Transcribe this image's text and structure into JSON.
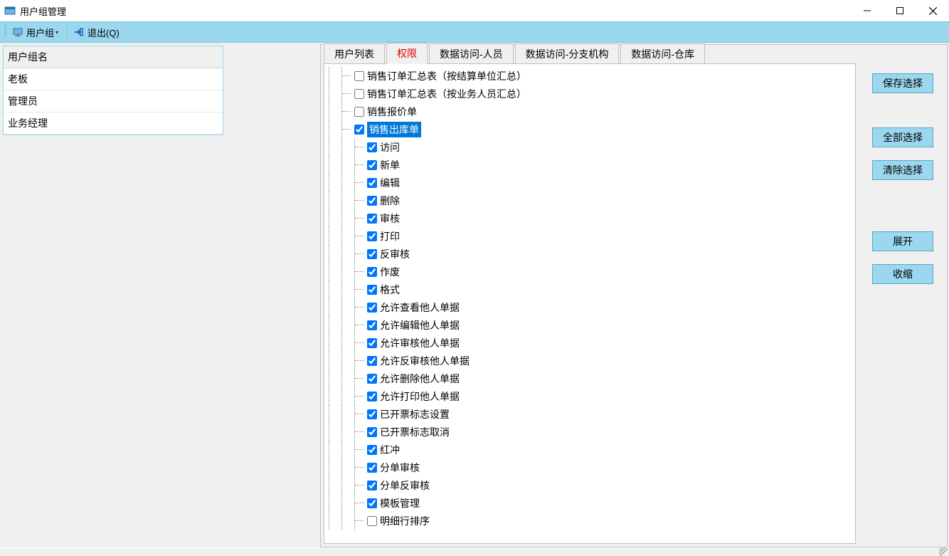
{
  "window": {
    "title": "用户组管理"
  },
  "toolbar": {
    "usergroup_label": "用户组",
    "exit_label": "退出(Q)"
  },
  "left": {
    "header": "用户组名",
    "rows": [
      "老板",
      "管理员",
      "业务经理"
    ]
  },
  "tabs": [
    "用户列表",
    "权限",
    "数据访问-人员",
    "数据访问-分支机构",
    "数据访问-仓库"
  ],
  "active_tab_index": 1,
  "buttons": {
    "save": "保存选择",
    "select_all": "全部选择",
    "clear": "清除选择",
    "expand": "展开",
    "collapse": "收缩"
  },
  "tree": [
    {
      "level": 2,
      "checked": false,
      "label": "销售订单汇总表（按结算单位汇总）",
      "selected": false
    },
    {
      "level": 2,
      "checked": false,
      "label": "销售订单汇总表（按业务人员汇总）",
      "selected": false
    },
    {
      "level": 2,
      "checked": false,
      "label": "销售报价单",
      "selected": false
    },
    {
      "level": 2,
      "checked": true,
      "label": "销售出库单",
      "selected": true
    },
    {
      "level": 3,
      "checked": true,
      "label": "访问",
      "selected": false
    },
    {
      "level": 3,
      "checked": true,
      "label": "新单",
      "selected": false
    },
    {
      "level": 3,
      "checked": true,
      "label": "编辑",
      "selected": false
    },
    {
      "level": 3,
      "checked": true,
      "label": "删除",
      "selected": false
    },
    {
      "level": 3,
      "checked": true,
      "label": "审核",
      "selected": false
    },
    {
      "level": 3,
      "checked": true,
      "label": "打印",
      "selected": false
    },
    {
      "level": 3,
      "checked": true,
      "label": "反审核",
      "selected": false
    },
    {
      "level": 3,
      "checked": true,
      "label": "作废",
      "selected": false
    },
    {
      "level": 3,
      "checked": true,
      "label": "格式",
      "selected": false
    },
    {
      "level": 3,
      "checked": true,
      "label": "允许查看他人单据",
      "selected": false
    },
    {
      "level": 3,
      "checked": true,
      "label": "允许编辑他人单据",
      "selected": false
    },
    {
      "level": 3,
      "checked": true,
      "label": "允许审核他人单据",
      "selected": false
    },
    {
      "level": 3,
      "checked": true,
      "label": "允许反审核他人单据",
      "selected": false
    },
    {
      "level": 3,
      "checked": true,
      "label": "允许删除他人单据",
      "selected": false
    },
    {
      "level": 3,
      "checked": true,
      "label": "允许打印他人单据",
      "selected": false
    },
    {
      "level": 3,
      "checked": true,
      "label": "已开票标志设置",
      "selected": false
    },
    {
      "level": 3,
      "checked": true,
      "label": "已开票标志取消",
      "selected": false
    },
    {
      "level": 3,
      "checked": true,
      "label": "红冲",
      "selected": false
    },
    {
      "level": 3,
      "checked": true,
      "label": "分单审核",
      "selected": false
    },
    {
      "level": 3,
      "checked": true,
      "label": "分单反审核",
      "selected": false
    },
    {
      "level": 3,
      "checked": true,
      "label": "模板管理",
      "selected": false
    },
    {
      "level": 3,
      "checked": false,
      "label": "明细行排序",
      "selected": false
    }
  ]
}
